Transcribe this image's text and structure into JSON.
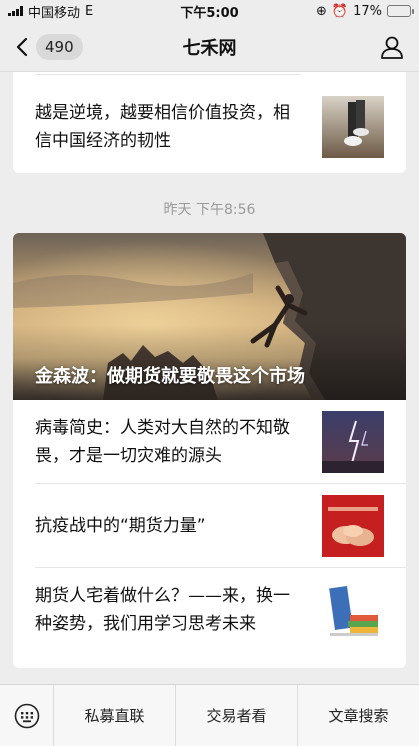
{
  "status_bar": {
    "carrier": "中国移动",
    "network": "E",
    "time": "下午5:00",
    "battery": "17%",
    "battery_level": 0.17
  },
  "nav": {
    "unread_count": "490",
    "title": "七禾网"
  },
  "articles_top": [
    {
      "title": "越是逆境，越要相信价值投资，相信中国经济的韧性",
      "thumb_icon": "runner-thumbnail"
    }
  ],
  "timestamp": "昨天 下午8:56",
  "hero": {
    "title": "金森波：做期货就要敬畏这个市场",
    "image": "rock-climber-cliff-image"
  },
  "articles": [
    {
      "title": "病毒简史：人类对大自然的不知敬畏，才是一切灾难的源头",
      "thumb_icon": "lightning-storm-thumbnail"
    },
    {
      "title": "抗疫战中的“期货力量”",
      "thumb_icon": "joined-hands-thumbnail"
    },
    {
      "title": "期货人宅着做什么？——来，换一种姿势，我们用学习思考未来",
      "thumb_icon": "books-thumbnail"
    }
  ],
  "bottom_menu": {
    "items": [
      "私募直联",
      "交易者看",
      "文章搜索"
    ]
  },
  "colors": {
    "background": "#ededed",
    "card": "#ffffff",
    "timestamp": "#9a9a9a",
    "battery_low": "#e2231a"
  }
}
